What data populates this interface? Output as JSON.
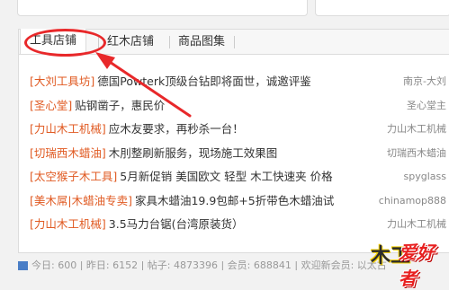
{
  "tabs": [
    {
      "label": "工具店铺",
      "active": true
    },
    {
      "label": "红木店铺",
      "active": false
    },
    {
      "label": "商品图集",
      "active": false
    }
  ],
  "rows": [
    {
      "tag": "[大刘工具坊]",
      "title": "德国Powterk顶级台钻即将面世，诚邀评鉴",
      "meta": "南京-大刘"
    },
    {
      "tag": "[圣心堂]",
      "title": "贴钢凿子，惠民价",
      "meta": "圣心堂主"
    },
    {
      "tag": "[力山木工机械]",
      "title": "应木友要求，再秒杀一台！",
      "meta": "力山木工机械"
    },
    {
      "tag": "[切瑞西木蜡油]",
      "title": "木刖整刷新服务，现场施工效果图",
      "meta": "切瑞西木蜡油"
    },
    {
      "tag": "[太空猴子木工具]",
      "title": "5月新促销 美国欧文 轻型 木工快速夹 价格",
      "meta": "spyglass"
    },
    {
      "tag": "[美木屌|木蜡油专卖]",
      "title": "家具木蜡油19.9包邮+5折带色木蜡油试",
      "meta": "chinamop888"
    },
    {
      "tag": "[力山木工机械]",
      "title": "3.5马力台锯(台湾原装货）",
      "meta": "力山木工机械"
    }
  ],
  "statusbar": {
    "text": "今日: 600 | 昨日: 6152 | 帖子: 4873396 | 会员: 688841 | 欢迎新会员: 以太古"
  },
  "logo": {
    "part1": "木工",
    "part2": "爱好者"
  },
  "colors": {
    "accent": "#e05a22",
    "annotation": "#e8282a"
  }
}
